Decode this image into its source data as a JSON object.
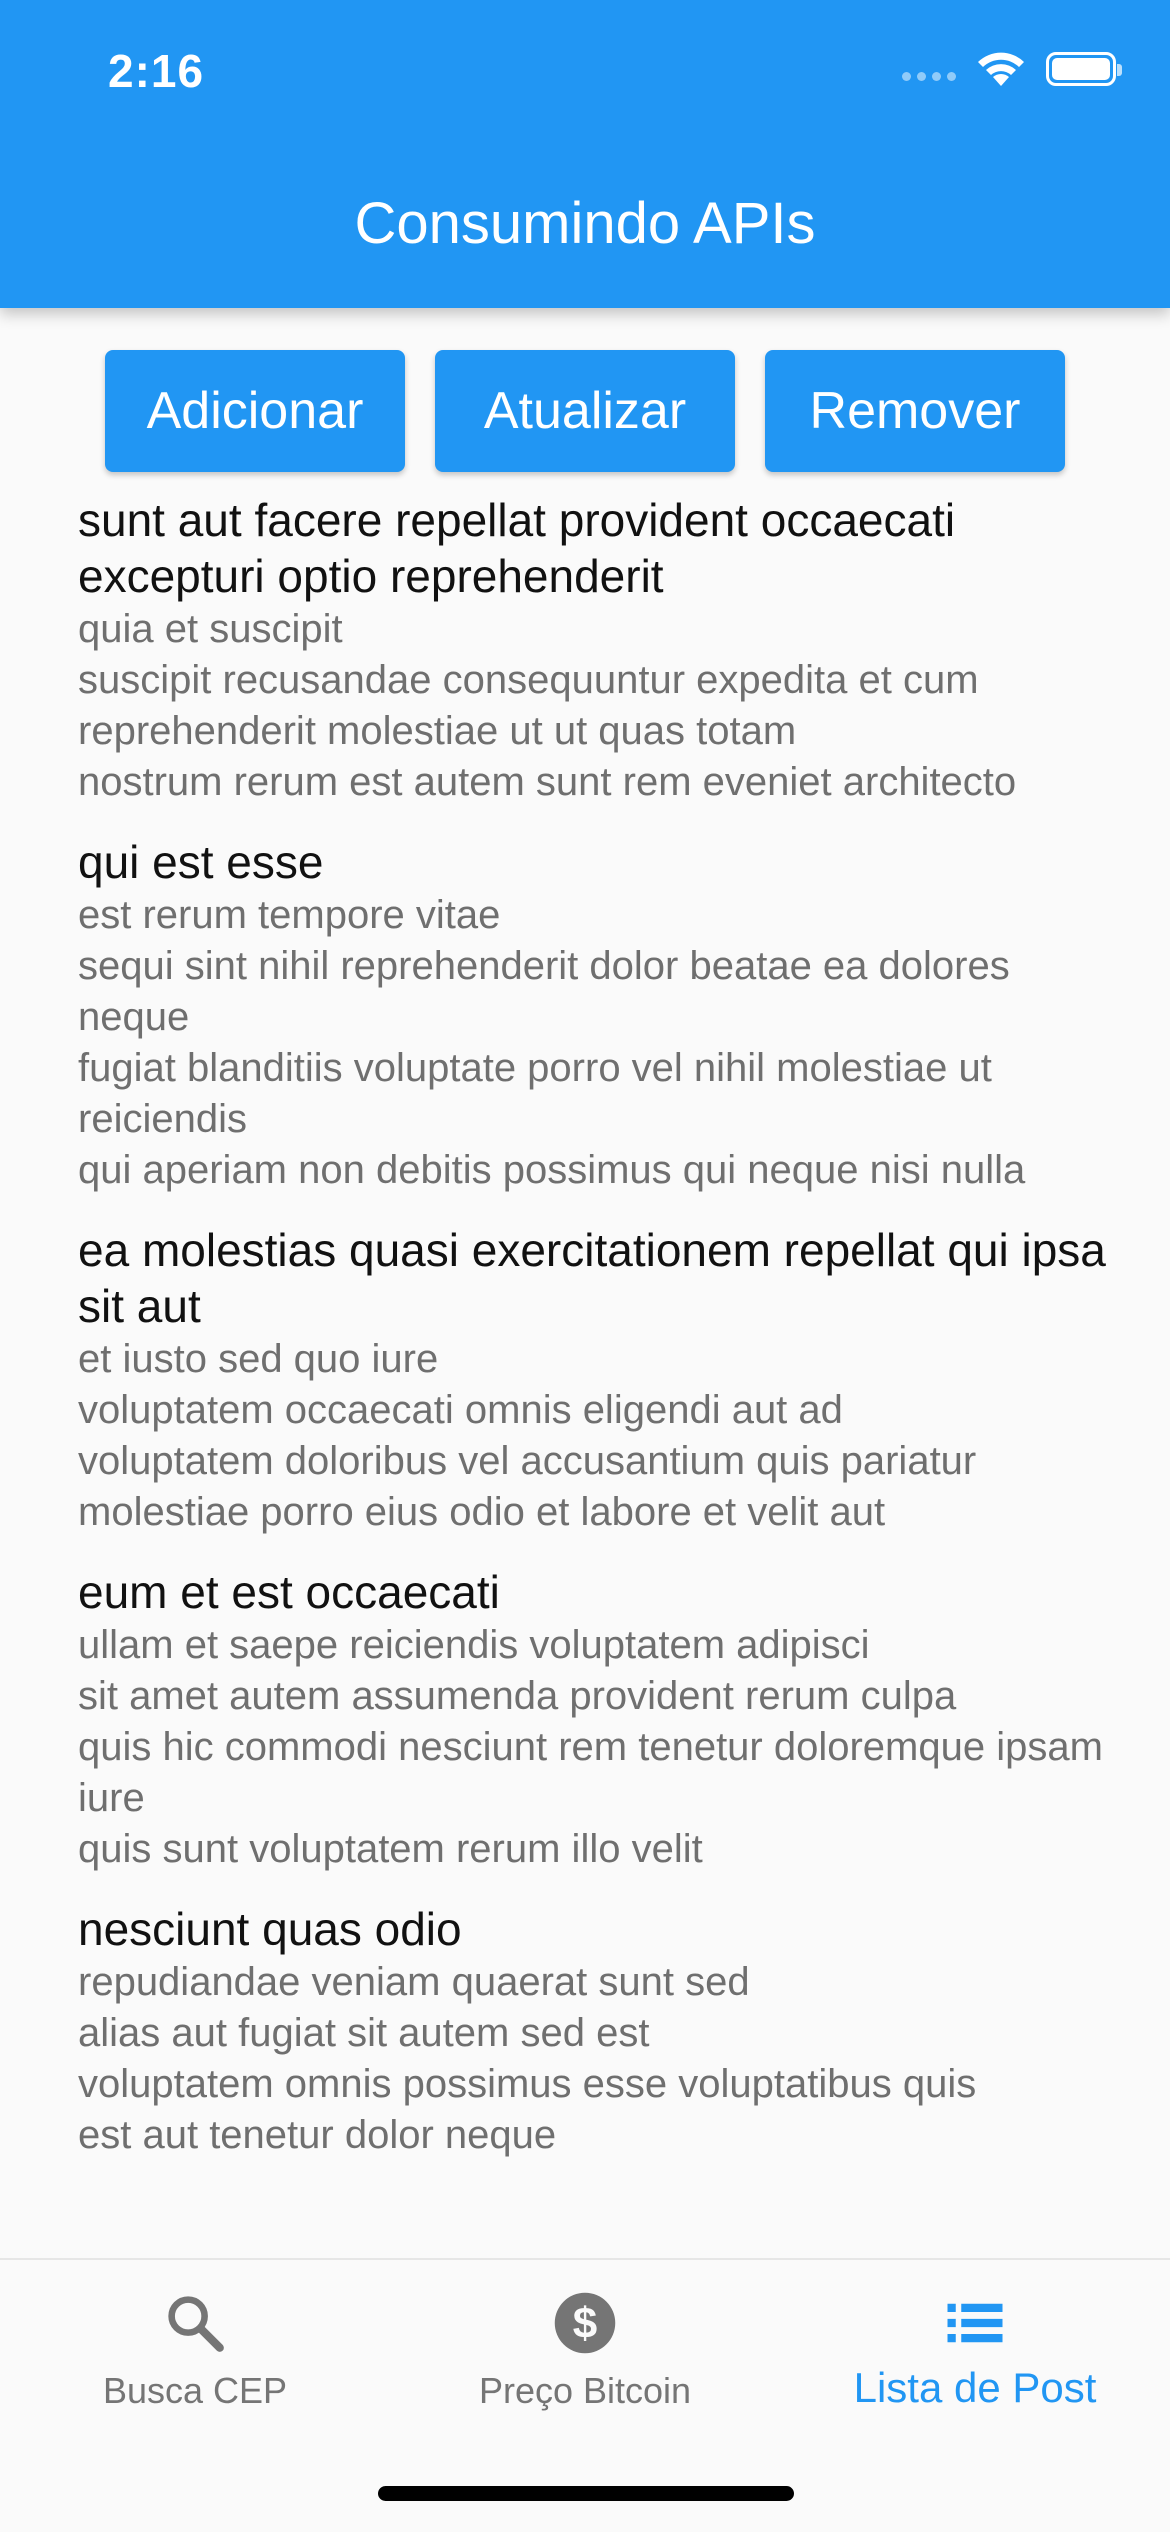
{
  "status_bar": {
    "time": "2:16"
  },
  "app_bar": {
    "title": "Consumindo APIs"
  },
  "actions": {
    "add": "Adicionar",
    "update": "Atualizar",
    "remove": "Remover"
  },
  "posts": [
    {
      "title": "sunt aut facere repellat provident occaecati excepturi optio reprehenderit",
      "body": "quia et suscipit\nsuscipit recusandae consequuntur expedita et cum reprehenderit molestiae ut ut quas totam\nnostrum rerum est autem sunt rem eveniet architecto"
    },
    {
      "title": "qui est esse",
      "body": "est rerum tempore vitae\nsequi sint nihil reprehenderit dolor beatae ea dolores neque\nfugiat blanditiis voluptate porro vel nihil molestiae ut reiciendis\nqui aperiam non debitis possimus qui neque nisi nulla"
    },
    {
      "title": "ea molestias quasi exercitationem repellat qui ipsa sit aut",
      "body": "et iusto sed quo iure\nvoluptatem occaecati omnis eligendi aut ad\nvoluptatem doloribus vel accusantium quis pariatur\nmolestiae porro eius odio et labore et velit aut"
    },
    {
      "title": "eum et est occaecati",
      "body": "ullam et saepe reiciendis voluptatem adipisci\nsit amet autem assumenda provident rerum culpa\nquis hic commodi nesciunt rem tenetur doloremque ipsam iure\nquis sunt voluptatem rerum illo velit"
    },
    {
      "title": "nesciunt quas odio",
      "body": "repudiandae veniam quaerat sunt sed\nalias aut fugiat sit autem sed est\nvoluptatem omnis possimus esse voluptatibus quis\nest aut tenetur dolor neque"
    }
  ],
  "bottom_nav": {
    "items": [
      {
        "label": "Busca CEP",
        "icon": "search-icon"
      },
      {
        "label": "Preço Bitcoin",
        "icon": "dollar-circle-icon"
      },
      {
        "label": "Lista de Post",
        "icon": "list-icon"
      }
    ],
    "active_index": 2
  },
  "colors": {
    "primary": "#2196f3",
    "inactive": "#757575"
  }
}
